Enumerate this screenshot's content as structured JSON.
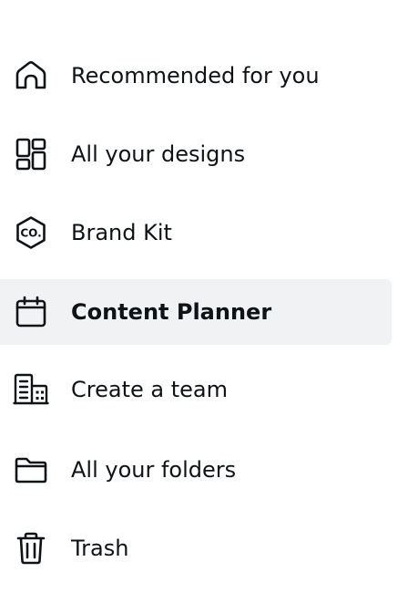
{
  "menu": {
    "items": [
      {
        "label": "Recommended for you",
        "icon": "home-icon",
        "active": false
      },
      {
        "label": "All your designs",
        "icon": "grid-icon",
        "active": false
      },
      {
        "label": "Brand Kit",
        "icon": "brand-kit-icon",
        "active": false,
        "icon_text": "CO."
      },
      {
        "label": "Content Planner",
        "icon": "calendar-icon",
        "active": true
      },
      {
        "label": "Create a team",
        "icon": "building-icon",
        "active": false
      },
      {
        "label": "All your folders",
        "icon": "folder-icon",
        "active": false
      },
      {
        "label": "Trash",
        "icon": "trash-icon",
        "active": false
      }
    ]
  },
  "colors": {
    "text": "#0e1318",
    "active_background": "#f1f2f4"
  }
}
